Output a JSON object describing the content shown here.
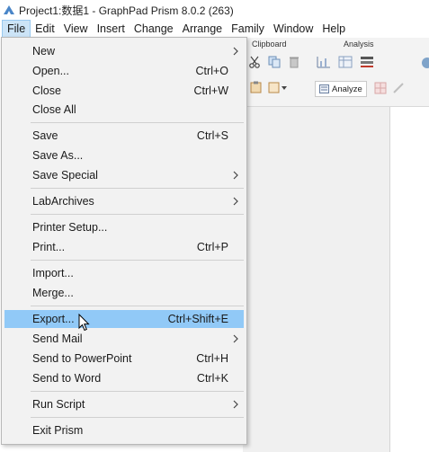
{
  "window": {
    "title": "Project1:数据1 - GraphPad Prism 8.0.2 (263)"
  },
  "menubar": {
    "items": [
      "File",
      "Edit",
      "View",
      "Insert",
      "Change",
      "Arrange",
      "Family",
      "Window",
      "Help"
    ]
  },
  "ribbon": {
    "clipboard_label": "Clipboard",
    "analysis_label": "Analysis",
    "analyze_label": "Analyze"
  },
  "file_menu": {
    "items": [
      {
        "label": "New",
        "shortcut": "",
        "submenu": true
      },
      {
        "label": "Open...",
        "shortcut": "Ctrl+O",
        "submenu": false
      },
      {
        "label": "Close",
        "shortcut": "Ctrl+W",
        "submenu": false
      },
      {
        "label": "Close All",
        "shortcut": "",
        "submenu": false
      },
      {
        "label": "Save",
        "shortcut": "Ctrl+S",
        "submenu": false
      },
      {
        "label": "Save As...",
        "shortcut": "",
        "submenu": false
      },
      {
        "label": "Save Special",
        "shortcut": "",
        "submenu": true
      },
      {
        "label": "LabArchives",
        "shortcut": "",
        "submenu": true
      },
      {
        "label": "Printer Setup...",
        "shortcut": "",
        "submenu": false
      },
      {
        "label": "Print...",
        "shortcut": "Ctrl+P",
        "submenu": false
      },
      {
        "label": "Import...",
        "shortcut": "",
        "submenu": false
      },
      {
        "label": "Merge...",
        "shortcut": "",
        "submenu": false
      },
      {
        "label": "Export...",
        "shortcut": "Ctrl+Shift+E",
        "submenu": false,
        "highlighted": true
      },
      {
        "label": "Send Mail",
        "shortcut": "",
        "submenu": true
      },
      {
        "label": "Send to PowerPoint",
        "shortcut": "Ctrl+H",
        "submenu": false
      },
      {
        "label": "Send to Word",
        "shortcut": "Ctrl+K",
        "submenu": false
      },
      {
        "label": "Run Script",
        "shortcut": "",
        "submenu": true
      },
      {
        "label": "Exit Prism",
        "shortcut": "",
        "submenu": false
      }
    ]
  },
  "colors": {
    "menu_bg": "#f2f2f2",
    "highlight": "#91c9f7",
    "active_menu": "#cce4f7"
  }
}
